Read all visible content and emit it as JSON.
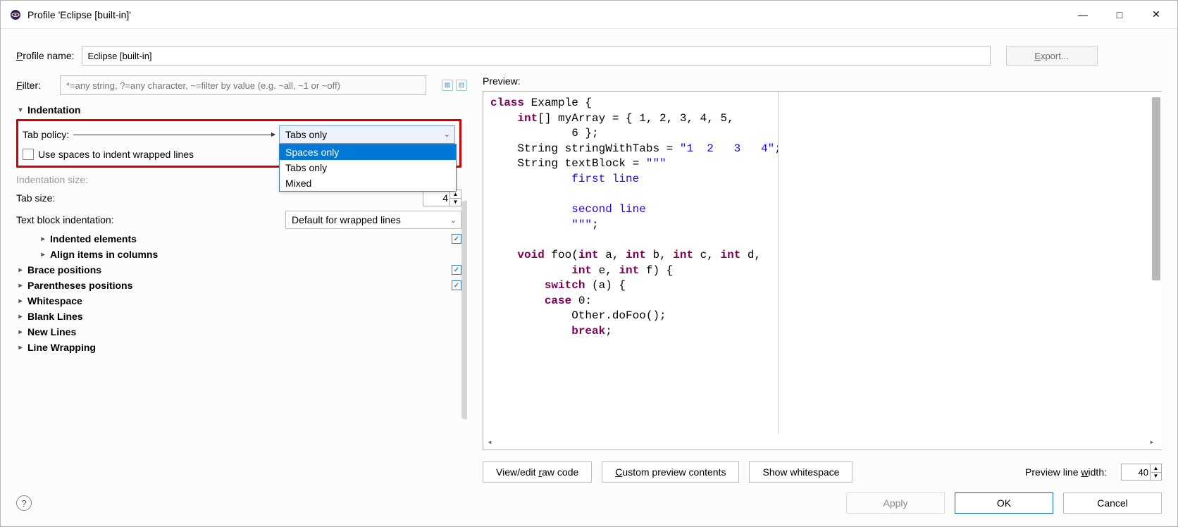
{
  "window": {
    "title": "Profile 'Eclipse [built-in]'"
  },
  "profile": {
    "label": "Profile name:",
    "value": "Eclipse [built-in]",
    "exportLabel": "Export..."
  },
  "filter": {
    "label": "Filter:",
    "placeholder": "*=any string, ?=any character, ~=filter by value (e.g. ~all, ~1 or ~off)"
  },
  "tree": {
    "indentation": {
      "label": "Indentation",
      "tabPolicy": {
        "label": "Tab policy:",
        "selected": "Tabs only",
        "optSpaces": "Spaces only",
        "optTabs": "Tabs only",
        "optMixed": "Mixed"
      },
      "useSpaces": "Use spaces to indent wrapped lines",
      "indentSize": "Indentation size:",
      "tabSize": {
        "label": "Tab size:",
        "value": "4"
      },
      "textBlock": {
        "label": "Text block indentation:",
        "value": "Default for wrapped lines"
      },
      "indentedElements": "Indented elements",
      "alignItems": "Align items in columns"
    },
    "bracePositions": "Brace positions",
    "parenPositions": "Parentheses positions",
    "whitespace": "Whitespace",
    "blankLines": "Blank Lines",
    "newLines": "New Lines",
    "lineWrapping": "Line Wrapping"
  },
  "preview": {
    "label": "Preview:",
    "code": {
      "l1a": "class",
      "l1b": " Example {",
      "l2a": "    int",
      "l2b": "[] myArray = { 1, 2, 3, 4, 5,",
      "l3": "            6 };",
      "l4a": "    String stringWithTabs = ",
      "l4b": "\"1  2   3   4\"",
      "l4c": ";",
      "l5a": "    String textBlock = ",
      "l5b": "\"\"\"",
      "l6": "            first line",
      "l7": "",
      "l8": "            second line",
      "l9": "            \"\"\"",
      "l9b": ";",
      "l10": "",
      "l11a": "    void",
      "l11b": " foo(",
      "l11c": "int",
      "l11d": " a, ",
      "l11e": "int",
      "l11f": " b, ",
      "l11g": "int",
      "l11h": " c, ",
      "l11i": "int",
      "l11j": " d,",
      "l12a": "            int",
      "l12b": " e, ",
      "l12c": "int",
      "l12d": " f) {",
      "l13a": "        switch",
      "l13b": " (a) {",
      "l14a": "        case",
      "l14b": " 0:",
      "l15": "            Other.doFoo();",
      "l16a": "            break",
      "l16b": ";"
    },
    "btnRaw": "View/edit raw code",
    "btnCustom": "Custom preview contents",
    "btnWhitespace": "Show whitespace",
    "lineWidthLabel": "Preview line width:",
    "lineWidth": "40"
  },
  "footer": {
    "apply": "Apply",
    "ok": "OK",
    "cancel": "Cancel"
  }
}
